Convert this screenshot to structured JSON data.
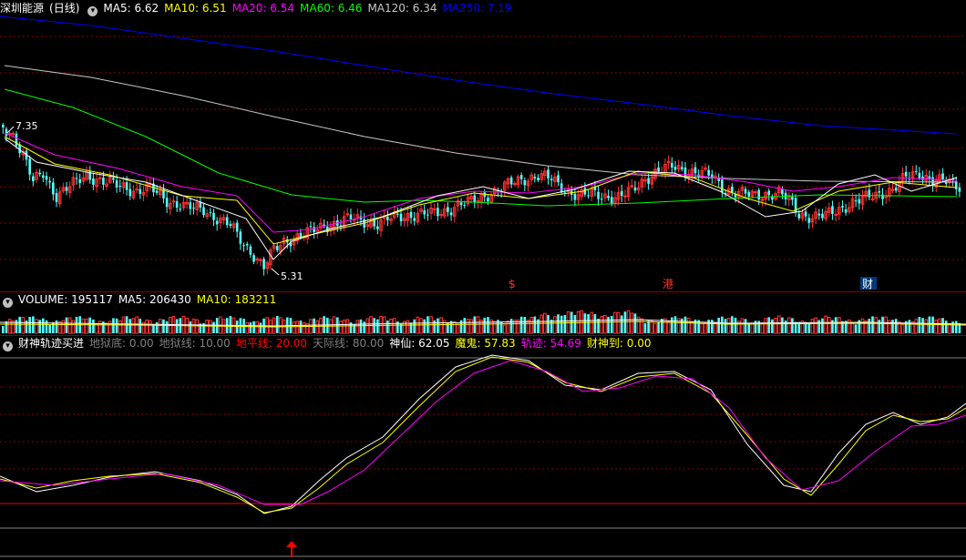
{
  "main_header": {
    "title": "深圳能源",
    "period": "(日线)",
    "ma": [
      {
        "label": "MA5: 6.62",
        "color": "#ffffff"
      },
      {
        "label": "MA10: 6.51",
        "color": "#ffff00"
      },
      {
        "label": "MA20: 6.54",
        "color": "#ff00ff"
      },
      {
        "label": "MA60: 6.46",
        "color": "#00ff00"
      },
      {
        "label": "MA120: 6.34",
        "color": "#c8c8c8"
      },
      {
        "label": "MA250: 7.19",
        "color": "#0000ff"
      }
    ]
  },
  "price_annotations": {
    "high": "7.35",
    "low": "5.31"
  },
  "markers": [
    {
      "text": "$",
      "color": "#ff3030"
    },
    {
      "text": "港",
      "color": "#ff3030"
    },
    {
      "text": "财",
      "color": "#ffffff"
    }
  ],
  "volume_header": {
    "items": [
      {
        "label": "VOLUME: 195117",
        "color": "#ffffff"
      },
      {
        "label": "MA5: 206430",
        "color": "#ffffff"
      },
      {
        "label": "MA10: 183211",
        "color": "#ffff00"
      }
    ]
  },
  "indicator_header": {
    "name": "财神轨迹买进",
    "items": [
      {
        "label": "地狱底: 0.00",
        "color": "#808080"
      },
      {
        "label": "地狱线: 10.00",
        "color": "#808080"
      },
      {
        "label": "地平线: 20.00",
        "color": "#ff0000"
      },
      {
        "label": "天际线: 80.00",
        "color": "#808080"
      },
      {
        "label": "神仙: 62.05",
        "color": "#ffffff"
      },
      {
        "label": "魔鬼: 57.83",
        "color": "#ffff00"
      },
      {
        "label": "轨迹: 54.69",
        "color": "#ff00ff"
      },
      {
        "label": "财神到: 0.00",
        "color": "#ffff00"
      }
    ]
  },
  "colors": {
    "up": "#ff3232",
    "down": "#54ffff",
    "bg": "#000000",
    "grid": "#8b0000"
  }
}
